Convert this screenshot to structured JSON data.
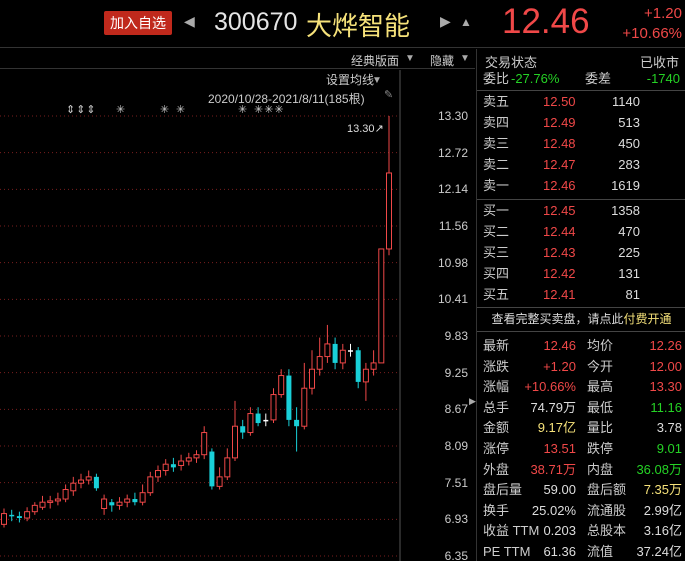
{
  "header": {
    "watch_label": "加入自选",
    "nav_left": "◀",
    "nav_right": "▶",
    "code": "300670",
    "name": "大烨智能",
    "bell": "▲",
    "price": "12.46",
    "change": "+1.20",
    "change_pct": "+10.66%"
  },
  "toolbar": {
    "classic": "经典版面",
    "hide": "隐藏"
  },
  "chart": {
    "ma_settings": "设置均线",
    "range": "2020/10/28-2021/8/11(185根)",
    "pin": "✎",
    "marks": [
      "⇕⇕⇕",
      "✳",
      "✳",
      "✳",
      "✳",
      "✳✳✳"
    ],
    "high_label": "13.30↗",
    "edge_arrow": "▶",
    "y_ticks": [
      "13.30",
      "12.72",
      "12.14",
      "11.56",
      "10.98",
      "10.41",
      "9.83",
      "9.25",
      "8.67",
      "8.09",
      "7.51",
      "6.93",
      "6.35"
    ],
    "colors": {
      "up": "#f04848",
      "down": "#19d0d8",
      "flat": "#ffffff",
      "grid": "#7a1e1e"
    }
  },
  "chart_data": {
    "type": "candlestick",
    "ylim": [
      6.35,
      13.3
    ],
    "candles": [
      [
        6.85,
        7.02,
        7.1,
        6.8
      ],
      [
        7.0,
        6.98,
        7.08,
        6.9
      ],
      [
        6.98,
        6.95,
        7.05,
        6.88
      ],
      [
        6.95,
        7.05,
        7.12,
        6.9
      ],
      [
        7.05,
        7.15,
        7.2,
        7.0
      ],
      [
        7.12,
        7.2,
        7.3,
        7.08
      ],
      [
        7.2,
        7.22,
        7.3,
        7.1
      ],
      [
        7.22,
        7.25,
        7.35,
        7.15
      ],
      [
        7.25,
        7.4,
        7.48,
        7.2
      ],
      [
        7.38,
        7.5,
        7.6,
        7.3
      ],
      [
        7.5,
        7.55,
        7.65,
        7.42
      ],
      [
        7.55,
        7.6,
        7.7,
        7.48
      ],
      [
        7.6,
        7.42,
        7.65,
        7.38
      ],
      [
        7.1,
        7.25,
        7.32,
        7.0
      ],
      [
        7.2,
        7.15,
        7.25,
        7.05
      ],
      [
        7.15,
        7.2,
        7.28,
        7.08
      ],
      [
        7.2,
        7.25,
        7.32,
        7.12
      ],
      [
        7.25,
        7.2,
        7.35,
        7.15
      ],
      [
        7.2,
        7.35,
        7.48,
        7.15
      ],
      [
        7.35,
        7.6,
        7.68,
        7.3
      ],
      [
        7.6,
        7.7,
        7.78,
        7.52
      ],
      [
        7.7,
        7.8,
        7.88,
        7.62
      ],
      [
        7.8,
        7.75,
        7.9,
        7.68
      ],
      [
        7.78,
        7.85,
        7.95,
        7.7
      ],
      [
        7.85,
        7.9,
        7.98,
        7.78
      ],
      [
        7.9,
        7.95,
        8.02,
        7.82
      ],
      [
        7.95,
        8.3,
        8.4,
        7.88
      ],
      [
        8.0,
        7.45,
        8.05,
        7.4
      ],
      [
        7.45,
        7.6,
        7.75,
        7.4
      ],
      [
        7.6,
        7.9,
        8.05,
        7.55
      ],
      [
        7.9,
        8.4,
        8.8,
        7.85
      ],
      [
        8.4,
        8.3,
        8.5,
        8.2
      ],
      [
        8.3,
        8.6,
        8.7,
        8.25
      ],
      [
        8.6,
        8.45,
        8.7,
        8.4
      ],
      [
        8.5,
        8.5,
        8.6,
        8.4
      ],
      [
        8.5,
        8.9,
        9.0,
        8.45
      ],
      [
        8.9,
        9.2,
        9.3,
        8.85
      ],
      [
        9.2,
        8.5,
        9.3,
        8.4
      ],
      [
        8.5,
        8.4,
        8.7,
        8.0
      ],
      [
        8.4,
        9.0,
        9.4,
        8.35
      ],
      [
        9.0,
        9.3,
        9.6,
        8.9
      ],
      [
        9.3,
        9.5,
        9.8,
        9.2
      ],
      [
        9.5,
        9.7,
        10.0,
        9.4
      ],
      [
        9.7,
        9.4,
        9.8,
        9.3
      ],
      [
        9.4,
        9.6,
        9.7,
        9.3
      ],
      [
        9.6,
        9.6,
        9.7,
        9.5
      ],
      [
        9.6,
        9.1,
        9.65,
        9.0
      ],
      [
        9.1,
        9.3,
        9.4,
        8.8
      ],
      [
        9.3,
        9.4,
        9.6,
        9.2
      ],
      [
        9.4,
        11.2,
        11.2,
        9.4
      ],
      [
        11.2,
        12.4,
        13.3,
        11.1
      ]
    ]
  },
  "right_panel": {
    "status_label": "交易状态",
    "status_value": "已收市",
    "webi_label": "委比",
    "webi_value": "-27.76%",
    "weicha_label": "委差",
    "weicha_value": "-1740",
    "asks": [
      {
        "label": "卖五",
        "price": "12.50",
        "vol": "1140"
      },
      {
        "label": "卖四",
        "price": "12.49",
        "vol": "513"
      },
      {
        "label": "卖三",
        "price": "12.48",
        "vol": "450"
      },
      {
        "label": "卖二",
        "price": "12.47",
        "vol": "283"
      },
      {
        "label": "卖一",
        "price": "12.46",
        "vol": "1619"
      }
    ],
    "bids": [
      {
        "label": "买一",
        "price": "12.45",
        "vol": "1358"
      },
      {
        "label": "买二",
        "price": "12.44",
        "vol": "470"
      },
      {
        "label": "买三",
        "price": "12.43",
        "vol": "225"
      },
      {
        "label": "买四",
        "price": "12.42",
        "vol": "131"
      },
      {
        "label": "买五",
        "price": "12.41",
        "vol": "81"
      }
    ],
    "full_prompt": "查看完整买卖盘，请点此",
    "full_link": "付费开通",
    "stats": [
      [
        "最新",
        "12.46",
        "red",
        "均价",
        "12.26",
        "red"
      ],
      [
        "涨跌",
        "+1.20",
        "red",
        "今开",
        "12.00",
        "red"
      ],
      [
        "涨幅",
        "+10.66%",
        "red",
        "最高",
        "13.30",
        "red"
      ],
      [
        "总手",
        "74.79万",
        "wht",
        "最低",
        "11.16",
        "grn"
      ],
      [
        "金额",
        "9.17亿",
        "ylw",
        "量比",
        "3.78",
        "wht"
      ],
      [
        "涨停",
        "13.51",
        "red",
        "跌停",
        "9.01",
        "grn"
      ],
      [
        "外盘",
        "38.71万",
        "red",
        "内盘",
        "36.08万",
        "grn"
      ],
      [
        "盘后量",
        "59.00",
        "wht",
        "盘后额",
        "7.35万",
        "ylw"
      ],
      [
        "换手",
        "25.02%",
        "wht",
        "流通股",
        "2.99亿",
        "wht"
      ],
      [
        "收益 TTM",
        "0.203",
        "wht",
        "总股本",
        "3.16亿",
        "wht"
      ],
      [
        "PE TTM",
        "61.36",
        "wht",
        "流值",
        "37.24亿",
        "wht"
      ]
    ]
  }
}
